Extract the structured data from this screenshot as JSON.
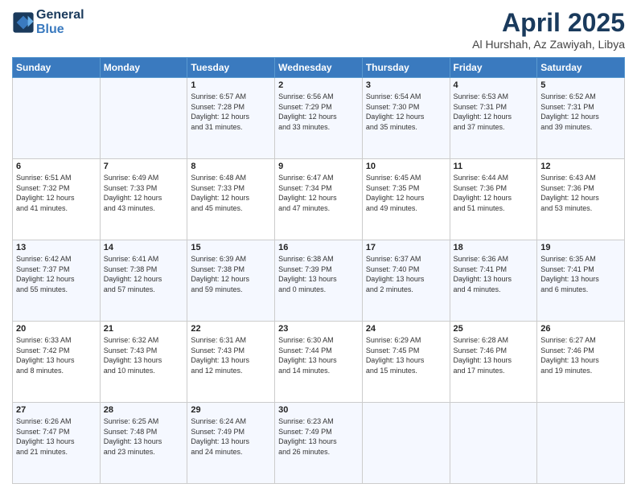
{
  "header": {
    "logo_line1": "General",
    "logo_line2": "Blue",
    "month": "April 2025",
    "location": "Al Hurshah, Az Zawiyah, Libya"
  },
  "days_of_week": [
    "Sunday",
    "Monday",
    "Tuesday",
    "Wednesday",
    "Thursday",
    "Friday",
    "Saturday"
  ],
  "weeks": [
    [
      {
        "day": "",
        "info": ""
      },
      {
        "day": "",
        "info": ""
      },
      {
        "day": "1",
        "info": "Sunrise: 6:57 AM\nSunset: 7:28 PM\nDaylight: 12 hours\nand 31 minutes."
      },
      {
        "day": "2",
        "info": "Sunrise: 6:56 AM\nSunset: 7:29 PM\nDaylight: 12 hours\nand 33 minutes."
      },
      {
        "day": "3",
        "info": "Sunrise: 6:54 AM\nSunset: 7:30 PM\nDaylight: 12 hours\nand 35 minutes."
      },
      {
        "day": "4",
        "info": "Sunrise: 6:53 AM\nSunset: 7:31 PM\nDaylight: 12 hours\nand 37 minutes."
      },
      {
        "day": "5",
        "info": "Sunrise: 6:52 AM\nSunset: 7:31 PM\nDaylight: 12 hours\nand 39 minutes."
      }
    ],
    [
      {
        "day": "6",
        "info": "Sunrise: 6:51 AM\nSunset: 7:32 PM\nDaylight: 12 hours\nand 41 minutes."
      },
      {
        "day": "7",
        "info": "Sunrise: 6:49 AM\nSunset: 7:33 PM\nDaylight: 12 hours\nand 43 minutes."
      },
      {
        "day": "8",
        "info": "Sunrise: 6:48 AM\nSunset: 7:33 PM\nDaylight: 12 hours\nand 45 minutes."
      },
      {
        "day": "9",
        "info": "Sunrise: 6:47 AM\nSunset: 7:34 PM\nDaylight: 12 hours\nand 47 minutes."
      },
      {
        "day": "10",
        "info": "Sunrise: 6:45 AM\nSunset: 7:35 PM\nDaylight: 12 hours\nand 49 minutes."
      },
      {
        "day": "11",
        "info": "Sunrise: 6:44 AM\nSunset: 7:36 PM\nDaylight: 12 hours\nand 51 minutes."
      },
      {
        "day": "12",
        "info": "Sunrise: 6:43 AM\nSunset: 7:36 PM\nDaylight: 12 hours\nand 53 minutes."
      }
    ],
    [
      {
        "day": "13",
        "info": "Sunrise: 6:42 AM\nSunset: 7:37 PM\nDaylight: 12 hours\nand 55 minutes."
      },
      {
        "day": "14",
        "info": "Sunrise: 6:41 AM\nSunset: 7:38 PM\nDaylight: 12 hours\nand 57 minutes."
      },
      {
        "day": "15",
        "info": "Sunrise: 6:39 AM\nSunset: 7:38 PM\nDaylight: 12 hours\nand 59 minutes."
      },
      {
        "day": "16",
        "info": "Sunrise: 6:38 AM\nSunset: 7:39 PM\nDaylight: 13 hours\nand 0 minutes."
      },
      {
        "day": "17",
        "info": "Sunrise: 6:37 AM\nSunset: 7:40 PM\nDaylight: 13 hours\nand 2 minutes."
      },
      {
        "day": "18",
        "info": "Sunrise: 6:36 AM\nSunset: 7:41 PM\nDaylight: 13 hours\nand 4 minutes."
      },
      {
        "day": "19",
        "info": "Sunrise: 6:35 AM\nSunset: 7:41 PM\nDaylight: 13 hours\nand 6 minutes."
      }
    ],
    [
      {
        "day": "20",
        "info": "Sunrise: 6:33 AM\nSunset: 7:42 PM\nDaylight: 13 hours\nand 8 minutes."
      },
      {
        "day": "21",
        "info": "Sunrise: 6:32 AM\nSunset: 7:43 PM\nDaylight: 13 hours\nand 10 minutes."
      },
      {
        "day": "22",
        "info": "Sunrise: 6:31 AM\nSunset: 7:43 PM\nDaylight: 13 hours\nand 12 minutes."
      },
      {
        "day": "23",
        "info": "Sunrise: 6:30 AM\nSunset: 7:44 PM\nDaylight: 13 hours\nand 14 minutes."
      },
      {
        "day": "24",
        "info": "Sunrise: 6:29 AM\nSunset: 7:45 PM\nDaylight: 13 hours\nand 15 minutes."
      },
      {
        "day": "25",
        "info": "Sunrise: 6:28 AM\nSunset: 7:46 PM\nDaylight: 13 hours\nand 17 minutes."
      },
      {
        "day": "26",
        "info": "Sunrise: 6:27 AM\nSunset: 7:46 PM\nDaylight: 13 hours\nand 19 minutes."
      }
    ],
    [
      {
        "day": "27",
        "info": "Sunrise: 6:26 AM\nSunset: 7:47 PM\nDaylight: 13 hours\nand 21 minutes."
      },
      {
        "day": "28",
        "info": "Sunrise: 6:25 AM\nSunset: 7:48 PM\nDaylight: 13 hours\nand 23 minutes."
      },
      {
        "day": "29",
        "info": "Sunrise: 6:24 AM\nSunset: 7:49 PM\nDaylight: 13 hours\nand 24 minutes."
      },
      {
        "day": "30",
        "info": "Sunrise: 6:23 AM\nSunset: 7:49 PM\nDaylight: 13 hours\nand 26 minutes."
      },
      {
        "day": "",
        "info": ""
      },
      {
        "day": "",
        "info": ""
      },
      {
        "day": "",
        "info": ""
      }
    ]
  ]
}
